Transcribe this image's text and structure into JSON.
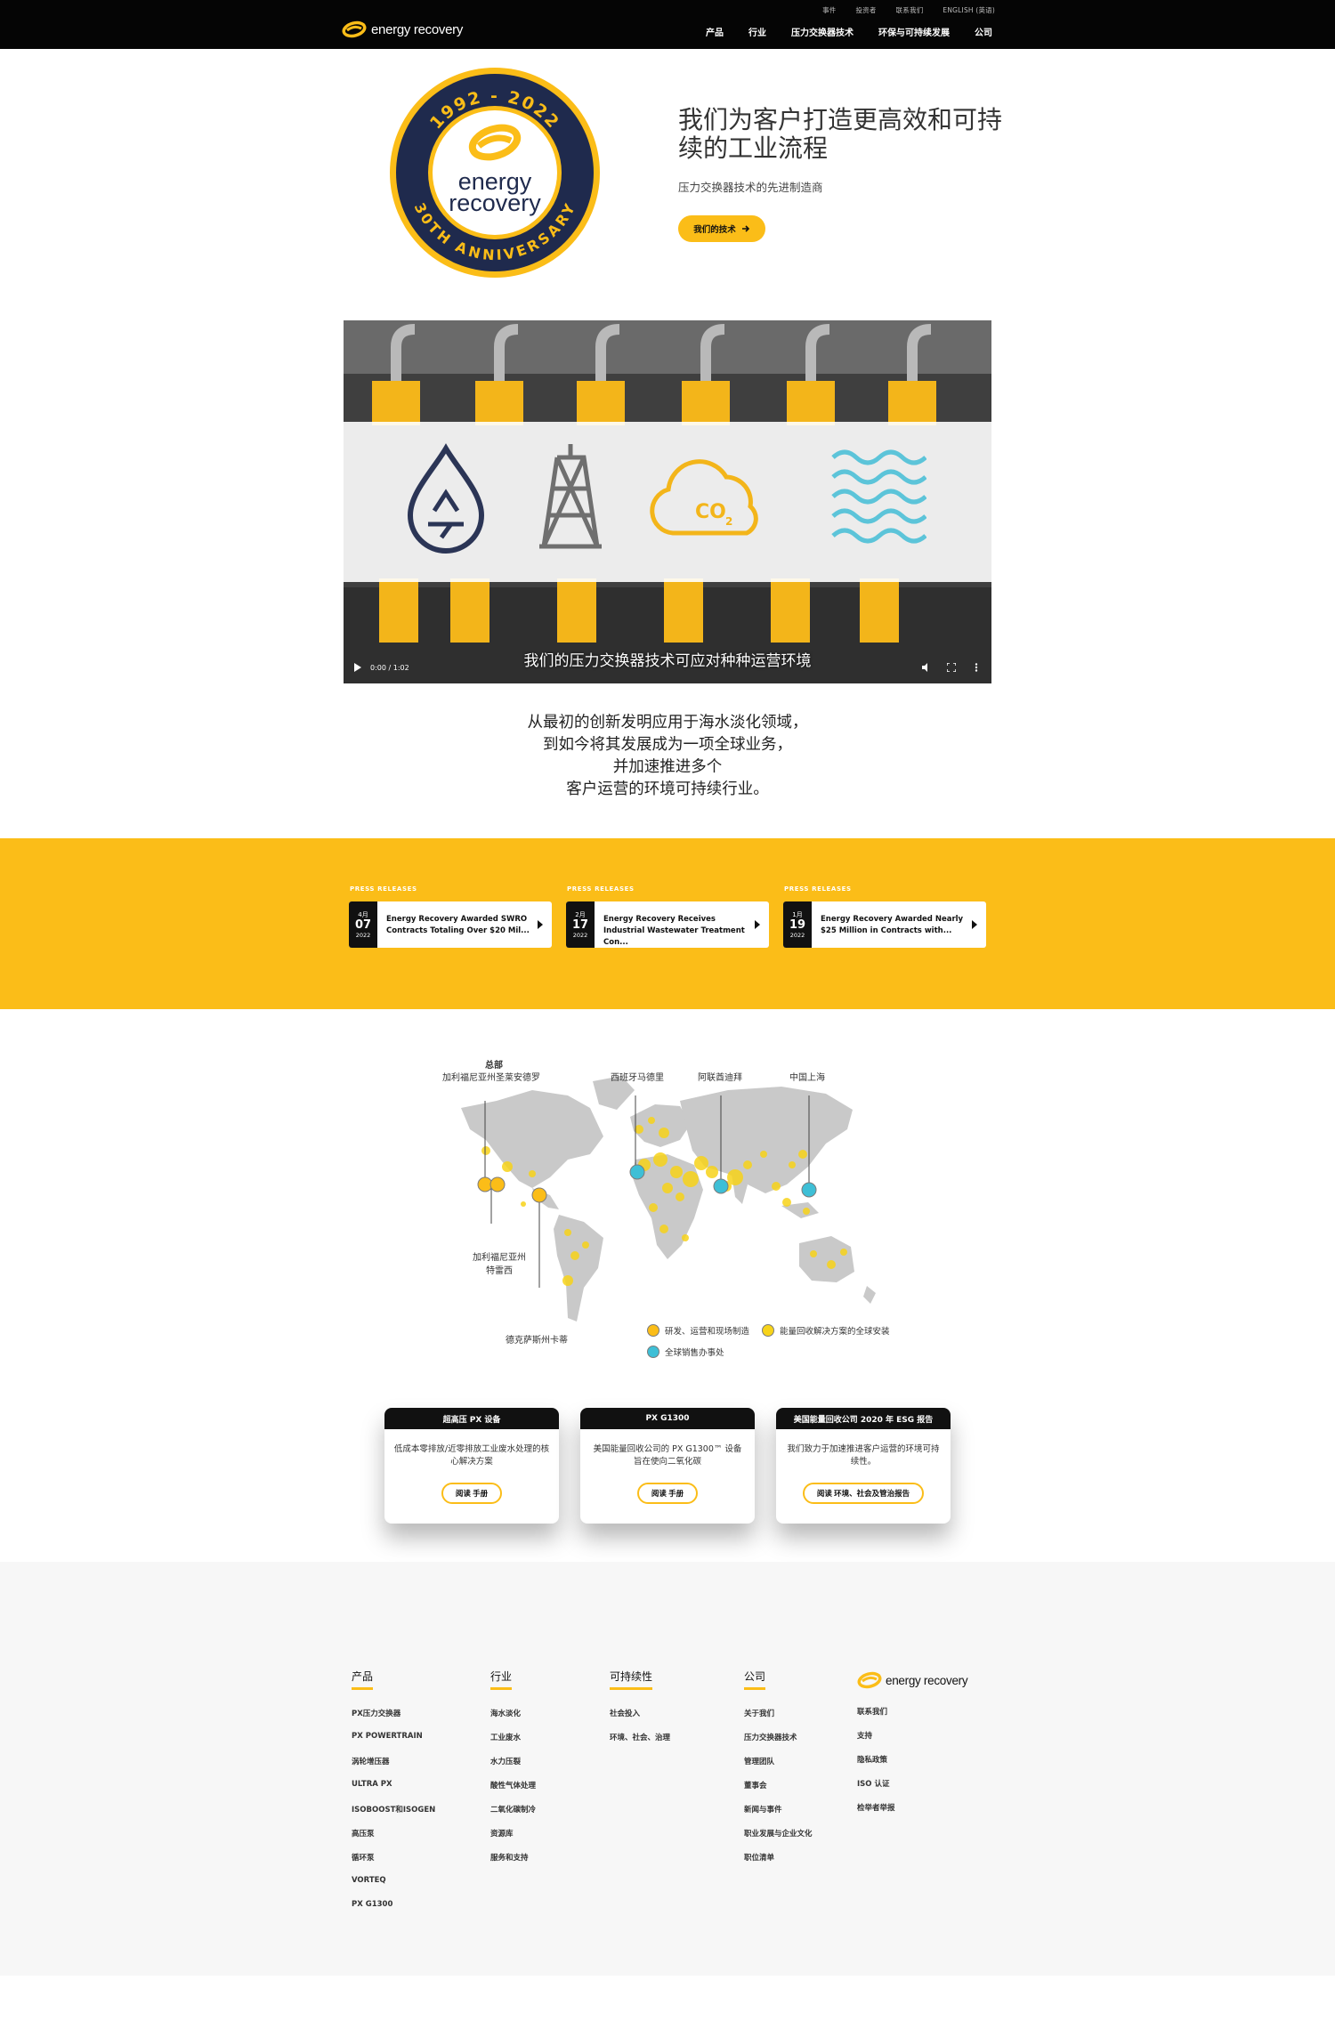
{
  "header": {
    "utility_links": [
      "事件",
      "投资者",
      "联系我们",
      "ENGLISH (英语)"
    ],
    "logo_text": "energy recovery",
    "nav": [
      "产品",
      "行业",
      "压力交换器技术",
      "环保与可持续发展",
      "公司"
    ]
  },
  "hero": {
    "badge_years": "1992 - 2022",
    "badge_name_1": "energy",
    "badge_name_2": "recovery",
    "badge_anniversary": "30TH ANNIVERSARY",
    "title": "我们为客户打造更高效和可持续的工业流程",
    "subtitle": "压力交换器技术的先进制造商",
    "button_label": "我们的技术"
  },
  "video": {
    "co2_label": "CO",
    "co2_sub": "2",
    "caption": "我们的压力交换器技术可应对种种运营环境",
    "time": "0:00 / 1:02"
  },
  "tagline": [
    "从最初的创新发明应用于海水淡化领域，",
    "到如今将其发展成为一项全球业务，",
    "并加速推进多个",
    "客户运营的环境可持续行业。"
  ],
  "press": [
    {
      "label": "PRESS RELEASES",
      "month": "4月",
      "day": "07",
      "year": "2022",
      "title": "Energy Recovery Awarded SWRO Contracts Totaling Over $20 Mil..."
    },
    {
      "label": "PRESS RELEASES",
      "month": "2月",
      "day": "17",
      "year": "2022",
      "title": "Energy Recovery Receives Industrial Wastewater Treatment Con..."
    },
    {
      "label": "PRESS RELEASES",
      "month": "1月",
      "day": "19",
      "year": "2022",
      "title": "Energy Recovery Awarded Nearly $25 Million in Contracts with..."
    }
  ],
  "map": {
    "hq_title": "总部",
    "hq": "加利福尼亚州圣莱安德罗",
    "madrid": "西班牙马德里",
    "dubai": "阿联酋迪拜",
    "shanghai": "中国上海",
    "tracy_1": "加利福尼亚州",
    "tracy_2": "特雷西",
    "katy": "德克萨斯州卡蒂",
    "legend": [
      "研发、运营和现场制造",
      "能量回收解决方案的全球安装",
      "全球销售办事处"
    ],
    "colors": {
      "facility": "#fbbd18",
      "install": "#f7d31a",
      "sales": "#3ebfd6",
      "land": "#c9c9c9"
    }
  },
  "cards": [
    {
      "head": "超高压 PX 设备",
      "body": "低成本零排放/近零排放工业废水处理的核心解决方案",
      "button": "阅读 手册"
    },
    {
      "head": "PX G1300",
      "body": "美国能量回收公司的 PX G1300™ 设备旨在使向二氧化碳",
      "button": "阅读 手册"
    },
    {
      "head": "美国能量回收公司 2020 年 ESG 报告",
      "body": "我们致力于加速推进客户运营的环境可持续性。",
      "button": "阅读 环境、社会及管治报告"
    }
  ],
  "footer": {
    "cols": [
      {
        "head": "产品",
        "items": [
          "PX压力交换器",
          "PX POWERTRAIN",
          "涡轮增压器",
          "ULTRA PX",
          "ISOBOOST和ISOGEN",
          "高压泵",
          "循环泵",
          "VORTEQ",
          "PX G1300"
        ]
      },
      {
        "head": "行业",
        "items": [
          "海水淡化",
          "工业废水",
          "水力压裂",
          "酸性气体处理",
          "二氧化碳制冷",
          "资源库",
          "服务和支持"
        ]
      },
      {
        "head": "可持续性",
        "items": [
          "社会投入",
          "环境、社会、治理"
        ]
      },
      {
        "head": "公司",
        "items": [
          "关于我们",
          "压力交换器技术",
          "管理团队",
          "董事会",
          "新闻与事件",
          "职业发展与企业文化",
          "职位清单"
        ]
      }
    ],
    "logo_text": "energy recovery",
    "links": [
      "联系我们",
      "支持",
      "隐私政策",
      "ISO 认证",
      "检举者举报"
    ]
  },
  "colors": {
    "brand_yellow": "#fbbd18",
    "navy": "#1f2a4d",
    "black": "#050505"
  }
}
